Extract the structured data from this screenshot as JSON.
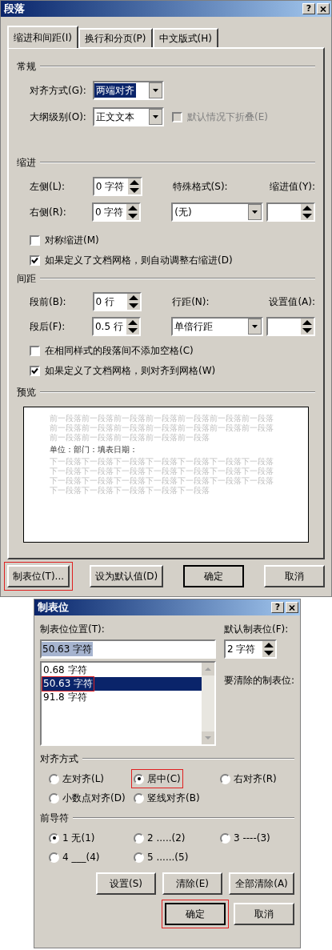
{
  "paragraph_dialog": {
    "title": "段落",
    "help_button": "?",
    "tabs": [
      {
        "label": "缩进和间距(I)",
        "selected": true
      },
      {
        "label": "换行和分页(P)",
        "selected": false
      },
      {
        "label": "中文版式(H)",
        "selected": false
      }
    ],
    "general": {
      "heading": "常规",
      "alignment": {
        "label": "对齐方式(G):",
        "value": "两端对齐"
      },
      "outline_level": {
        "label": "大纲级别(O):",
        "value": "正文文本"
      },
      "collapse": {
        "label": "默认情况下折叠(E)",
        "checked": false,
        "disabled": true
      }
    },
    "indent": {
      "heading": "缩进",
      "left": {
        "label": "左侧(L):",
        "value": "0 字符"
      },
      "right": {
        "label": "右侧(R):",
        "value": "0 字符"
      },
      "special": {
        "label": "特殊格式(S):",
        "value": "(无)"
      },
      "by": {
        "label": "缩进值(Y):"
      },
      "checkboxes": [
        {
          "label": "对称缩进(M)",
          "checked": false
        },
        {
          "label": "如果定义了文档网格，则自动调整右缩进(D)",
          "checked": true
        }
      ]
    },
    "spacing": {
      "heading": "间距",
      "before": {
        "label": "段前(B):",
        "value": "0 行"
      },
      "after": {
        "label": "段后(F):",
        "value": "0.5 行"
      },
      "line_spacing": {
        "label": "行距(N):",
        "value": "单倍行距"
      },
      "at": {
        "label": "设置值(A):"
      },
      "checkboxes": [
        {
          "label": "在相同样式的段落间不添加空格(C)",
          "checked": false
        },
        {
          "label": "如果定义了文档网格，则对齐到网格(W)",
          "checked": true
        }
      ]
    },
    "preview": {
      "heading": "预览",
      "paragraphs": [
        {
          "kind": "sample",
          "text": "前一段落前一段落前一段落前一段落前一段落前一段落前一段落前一段落前一段落前一段落前一段落前一段落前一段落前一段落前一段落前一段落前一段落前一段落前一段落"
        },
        {
          "kind": "current",
          "text": "单位：部门：填表日期："
        },
        {
          "kind": "sample",
          "text": "下一段落下一段落下一段落下一段落下一段落下一段落下一段落下一段落下一段落下一段落下一段落下一段落下一段落下一段落下一段落下一段落下一段落下一段落下一段落下一段落下一段落下一段落下一段落下一段落下一段落下一段落"
        }
      ]
    },
    "buttons": [
      {
        "label": "制表位(T)...",
        "default": false,
        "highlighted": true
      },
      {
        "label": "设为默认值(D)",
        "default": false,
        "highlighted": false
      },
      {
        "label": "确定",
        "default": true,
        "highlighted": false
      },
      {
        "label": "取消",
        "default": false,
        "highlighted": false
      }
    ]
  },
  "tabs_dialog": {
    "title": "制表位",
    "help_button": "?",
    "position": {
      "label": "制表位位置(T):",
      "value": "50.63 字符"
    },
    "positions": [
      {
        "label": "0.68 字符",
        "selected": false,
        "highlighted": false
      },
      {
        "label": "50.63 字符",
        "selected": true,
        "highlighted": true
      },
      {
        "label": "91.8 字符",
        "selected": false,
        "highlighted": false
      }
    ],
    "default_stops": {
      "label": "默认制表位(F):",
      "value": "2 字符"
    },
    "clear_label": "要清除的制表位:",
    "alignment": {
      "heading": "对齐方式",
      "options": [
        {
          "label": "左对齐(L)",
          "selected": false,
          "highlighted": false
        },
        {
          "label": "居中(C)",
          "selected": true,
          "highlighted": true
        },
        {
          "label": "右对齐(R)",
          "selected": false,
          "highlighted": false
        },
        {
          "label": "小数点对齐(D)",
          "selected": false,
          "highlighted": false
        },
        {
          "label": "竖线对齐(B)",
          "selected": false,
          "highlighted": false
        }
      ]
    },
    "leader": {
      "heading": "前导符",
      "options": [
        {
          "label": "1 无(1)",
          "selected": true
        },
        {
          "label": "2 .....(2)",
          "selected": false
        },
        {
          "label": "3 ----(3)",
          "selected": false
        },
        {
          "label": "4 ___(4)",
          "selected": false
        },
        {
          "label": "5 ......(5)",
          "selected": false
        }
      ]
    },
    "buttons": [
      {
        "label": "设置(S)",
        "default": false,
        "highlighted": false
      },
      {
        "label": "清除(E)",
        "default": false,
        "highlighted": false
      },
      {
        "label": "全部清除(A)",
        "default": false,
        "highlighted": false
      }
    ],
    "bottom_buttons": [
      {
        "label": "确定",
        "default": true,
        "highlighted": true
      },
      {
        "label": "取消",
        "default": false,
        "highlighted": false
      }
    ]
  }
}
